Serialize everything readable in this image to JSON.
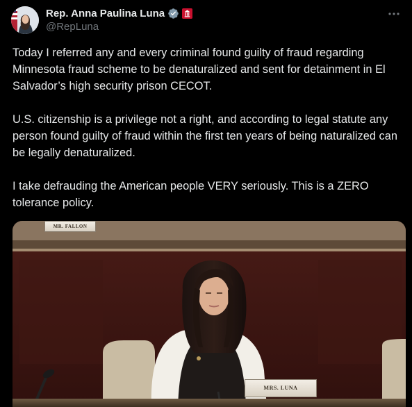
{
  "author": {
    "display_name": "Rep. Anna Paulina Luna",
    "handle": "@RepLuna",
    "verified_icon": "verified-badge-icon",
    "affiliation_icon": "us-congress-badge-icon"
  },
  "tweet": {
    "paragraphs": [
      "Today I referred any and every criminal found guilty of fraud regarding Minnesota fraud scheme to be denaturalized and sent for detainment in El Salvador’s high security prison CECOT.",
      "U.S. citizenship is a privilege not a right, and according to legal statute any person found guilty of fraud within the first ten years of being naturalized can be legally denaturalized.",
      "I take defrauding the American people VERY seriously. This is a ZERO tolerance policy."
    ]
  },
  "media": {
    "placard_left": "MR. FALLON",
    "placard_front": "MRS. LUNA"
  },
  "colors": {
    "background": "#000000",
    "text_primary": "#e7e9ea",
    "text_secondary": "#71767b",
    "verified_blue": "#1d9bf0",
    "gov_red": "#c8102e"
  }
}
